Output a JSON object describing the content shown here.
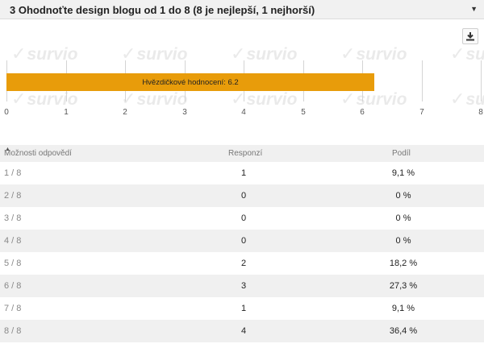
{
  "question": {
    "title": "3 Ohodnoťte design blogu od 1 do 8 (8 je nejlepší, 1 nejhorší)"
  },
  "icons": {
    "dropdown": "caret-down-icon",
    "download": "download-icon"
  },
  "watermark": {
    "text": "survio"
  },
  "chart_data": {
    "type": "bar",
    "orientation": "horizontal",
    "categories": [
      "Hvězdičkové hodnocení"
    ],
    "values": [
      6.2
    ],
    "bar_label": "Hvězdičkové hodnocení: 6.2",
    "xlim": [
      0,
      8
    ],
    "x_ticks": [
      "0",
      "1",
      "2",
      "3",
      "4",
      "5",
      "6",
      "7",
      "8"
    ],
    "grid": true,
    "bar_color": "#e89c0a"
  },
  "table": {
    "headers": [
      "Možnosti odpovědí",
      "Responzí",
      "Podíl"
    ],
    "rows": [
      {
        "option": "1 / 8",
        "responses": "1",
        "share": "9,1 %"
      },
      {
        "option": "2 / 8",
        "responses": "0",
        "share": "0 %"
      },
      {
        "option": "3 / 8",
        "responses": "0",
        "share": "0 %"
      },
      {
        "option": "4 / 8",
        "responses": "0",
        "share": "0 %"
      },
      {
        "option": "5 / 8",
        "responses": "2",
        "share": "18,2 %"
      },
      {
        "option": "6 / 8",
        "responses": "3",
        "share": "27,3 %"
      },
      {
        "option": "7 / 8",
        "responses": "1",
        "share": "9,1 %"
      },
      {
        "option": "8 / 8",
        "responses": "4",
        "share": "36,4 %"
      }
    ]
  }
}
